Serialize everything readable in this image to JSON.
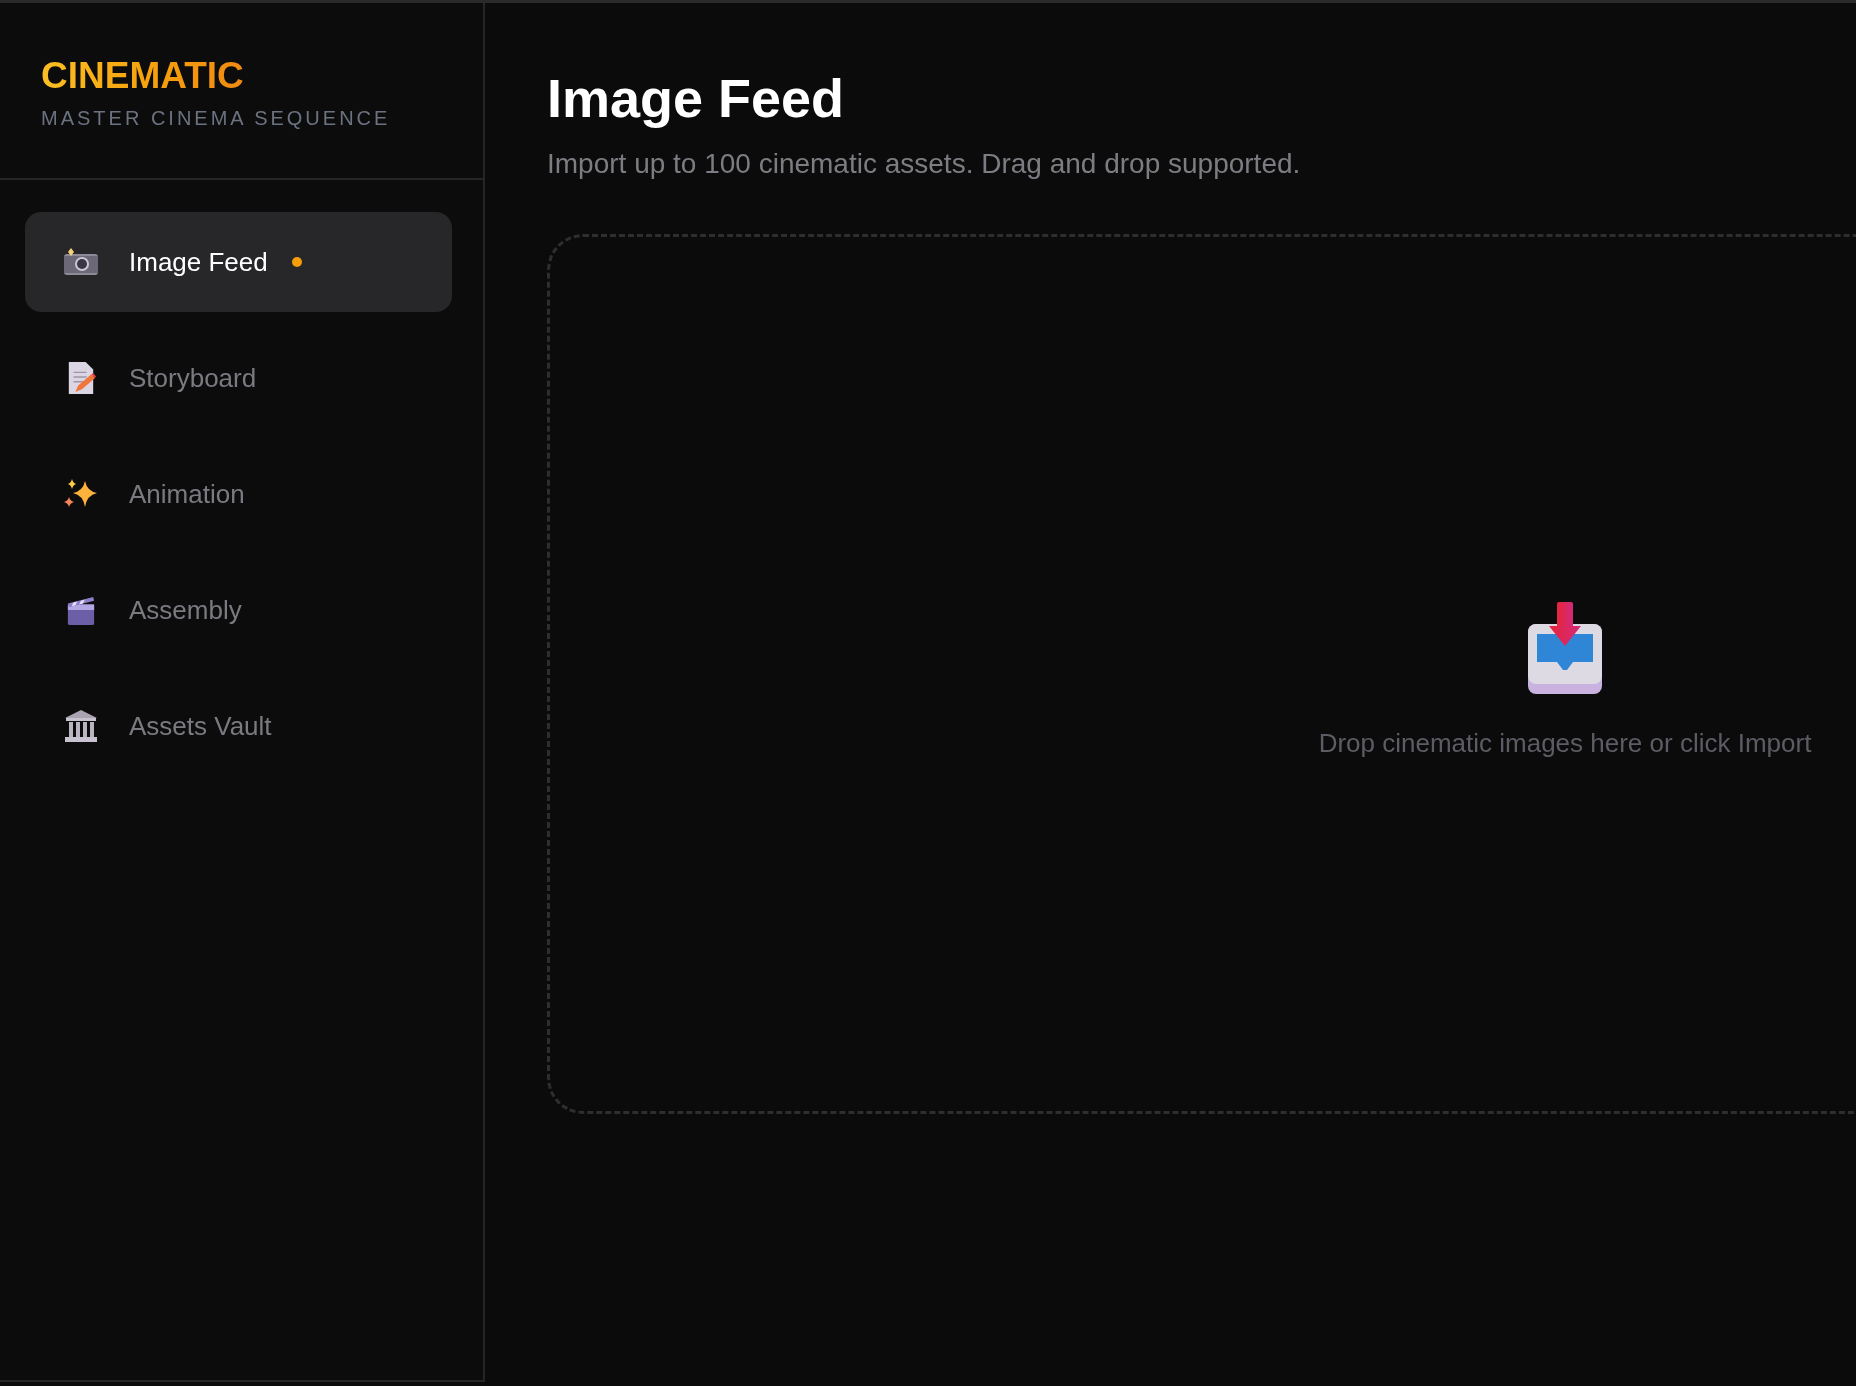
{
  "sidebar": {
    "brand": "CINEMATIC",
    "tagline": "MASTER CINEMA SEQUENCE",
    "items": [
      {
        "label": "Image Feed",
        "selected": true,
        "indicator": true
      },
      {
        "label": "Storyboard",
        "selected": false,
        "indicator": false
      },
      {
        "label": "Animation",
        "selected": false,
        "indicator": false
      },
      {
        "label": "Assembly",
        "selected": false,
        "indicator": false
      },
      {
        "label": "Assets Vault",
        "selected": false,
        "indicator": false
      }
    ]
  },
  "main": {
    "title": "Image Feed",
    "subtitle": "Import up to 100 cinematic assets. Drag and drop supported.",
    "dropzone": {
      "hint": "Drop cinematic images here or click Import"
    }
  }
}
